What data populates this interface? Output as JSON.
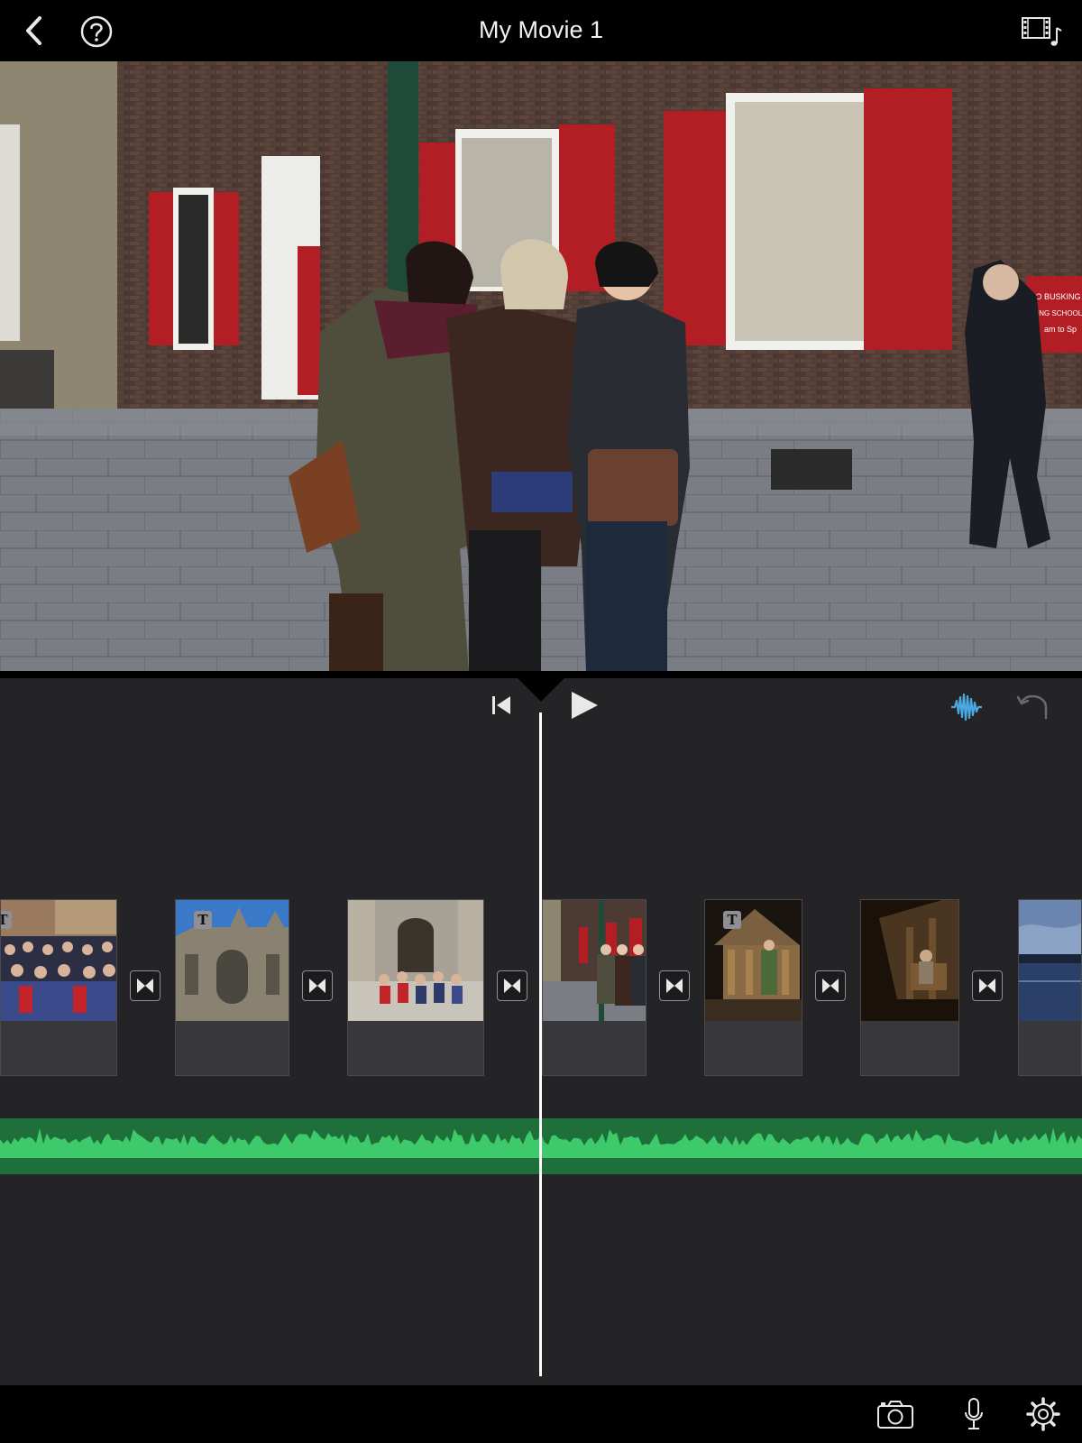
{
  "header": {
    "title": "My Movie 1",
    "back_icon": "chevron-left-icon",
    "help_icon": "question-circle-icon",
    "media_icon": "film-music-icon"
  },
  "viewer": {
    "sign_text": [
      "NO BUSKING P",
      "ING SCHOOL",
      "am to Sp"
    ]
  },
  "controls": {
    "skip_start_icon": "skip-to-start-icon",
    "play_icon": "play-icon",
    "audio_waveform_icon": "waveform-icon",
    "undo_icon": "undo-icon",
    "accent_color": "#4aa8e0"
  },
  "timeline": {
    "clips": [
      {
        "name": "group-photo-street",
        "has_title": true
      },
      {
        "name": "cathedral-facade",
        "has_title": true
      },
      {
        "name": "group-on-steps",
        "has_title": false
      },
      {
        "name": "three-women-street",
        "has_title": false
      },
      {
        "name": "viking-hut-figure",
        "has_title": true
      },
      {
        "name": "dark-workshop-figure",
        "has_title": false
      },
      {
        "name": "river-dusk",
        "has_title": false
      }
    ],
    "title_badge": "T",
    "transition_icon": "transition-bowtie-icon",
    "audio_color": "#1f6f3a",
    "waveform_color": "#3ec96a"
  },
  "footer": {
    "camera_icon": "camera-icon",
    "mic_icon": "microphone-icon",
    "settings_icon": "gear-icon"
  }
}
